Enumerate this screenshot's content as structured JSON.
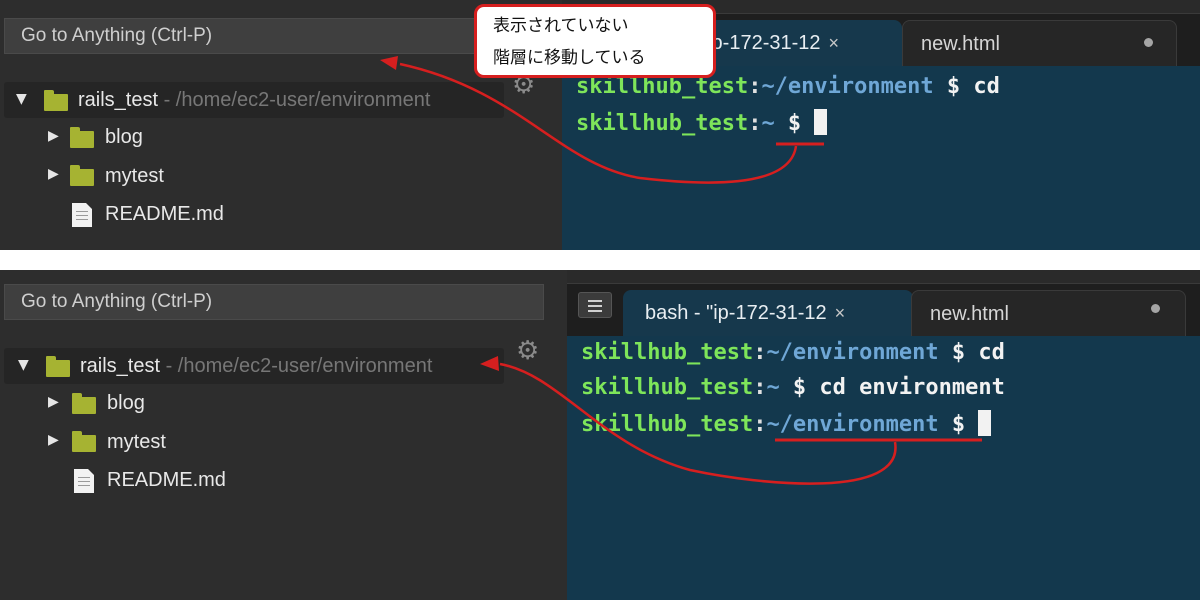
{
  "colors": {
    "accent_red": "#d61f1f",
    "prompt_user": "#7ee55a",
    "prompt_path": "#6fa7d6",
    "terminal_bg": "#13384d",
    "folder": "#a6b332"
  },
  "top": {
    "goto": "Go to Anything (Ctrl-P)",
    "tree": {
      "root_name": "rails_test",
      "root_path": " - /home/ec2-user/environment",
      "items": [
        "blog",
        "mytest",
        "README.md"
      ]
    },
    "tabs": {
      "active_label": "\"ip-172-31-12",
      "inactive_label": "new.html"
    },
    "terminal": {
      "line1": {
        "user": "skillhub_test",
        "colon": ":",
        "path": "~/environment",
        "cmd": " $ cd"
      },
      "line2": {
        "user": "skillhub_test",
        "colon": ":",
        "path": "~",
        "cmd": " $ "
      }
    }
  },
  "bottom": {
    "goto": "Go to Anything (Ctrl-P)",
    "tree": {
      "root_name": "rails_test",
      "root_path": " - /home/ec2-user/environment",
      "items": [
        "blog",
        "mytest",
        "README.md"
      ]
    },
    "tabs": {
      "active_label": "bash - \"ip-172-31-12",
      "inactive_label": "new.html"
    },
    "terminal": {
      "line1": {
        "user": "skillhub_test",
        "colon": ":",
        "path": "~/environment",
        "cmd": " $ cd"
      },
      "line2": {
        "user": "skillhub_test",
        "colon": ":",
        "path": "~",
        "cmd": " $ cd environment"
      },
      "line3": {
        "user": "skillhub_test",
        "colon": ":",
        "path": "~/environment",
        "cmd": " $ "
      }
    }
  },
  "annotation": {
    "line1": "表示されていない",
    "line2": "階層に移動している"
  },
  "icons": {
    "close": "close-icon",
    "gear": "gear-icon",
    "folder": "folder-icon",
    "file": "file-icon",
    "expand": "triangle-down-icon",
    "collapse": "triangle-right-icon",
    "menu": "terminal-menu-icon",
    "unsaved": "unsaved-dot-icon"
  }
}
